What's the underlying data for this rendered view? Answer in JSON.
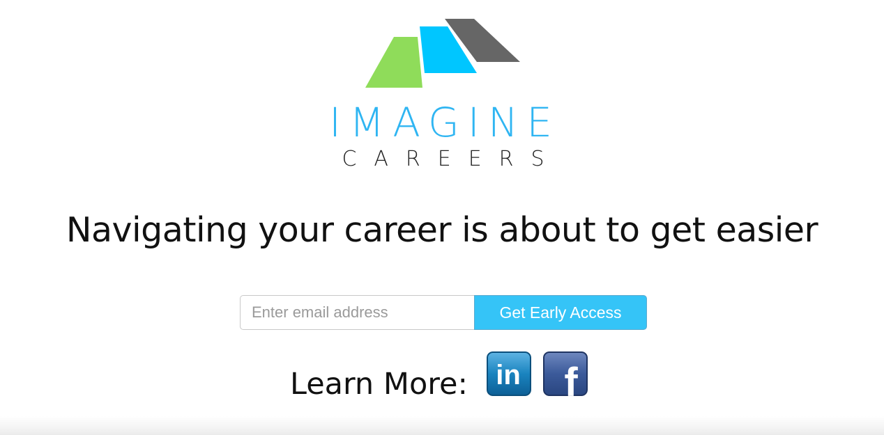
{
  "brand": {
    "line1": "IMAGINE",
    "line2": "CAREERS",
    "colors": {
      "green": "#8fdc5a",
      "blue": "#00c6ff",
      "gray": "#666666",
      "wordmark_blue": "#2fb5f2"
    }
  },
  "headline": "Navigating your career is about to get easier",
  "signup": {
    "email_placeholder": "Enter email address",
    "button_label": "Get Early Access",
    "button_color": "#35c4f7"
  },
  "learn_more": {
    "label": "Learn More:",
    "links": [
      {
        "icon": "linkedin-icon",
        "text": "in",
        "color": "#1a84bf"
      },
      {
        "icon": "facebook-icon",
        "text": "f",
        "color": "#3b5a9a"
      }
    ]
  }
}
